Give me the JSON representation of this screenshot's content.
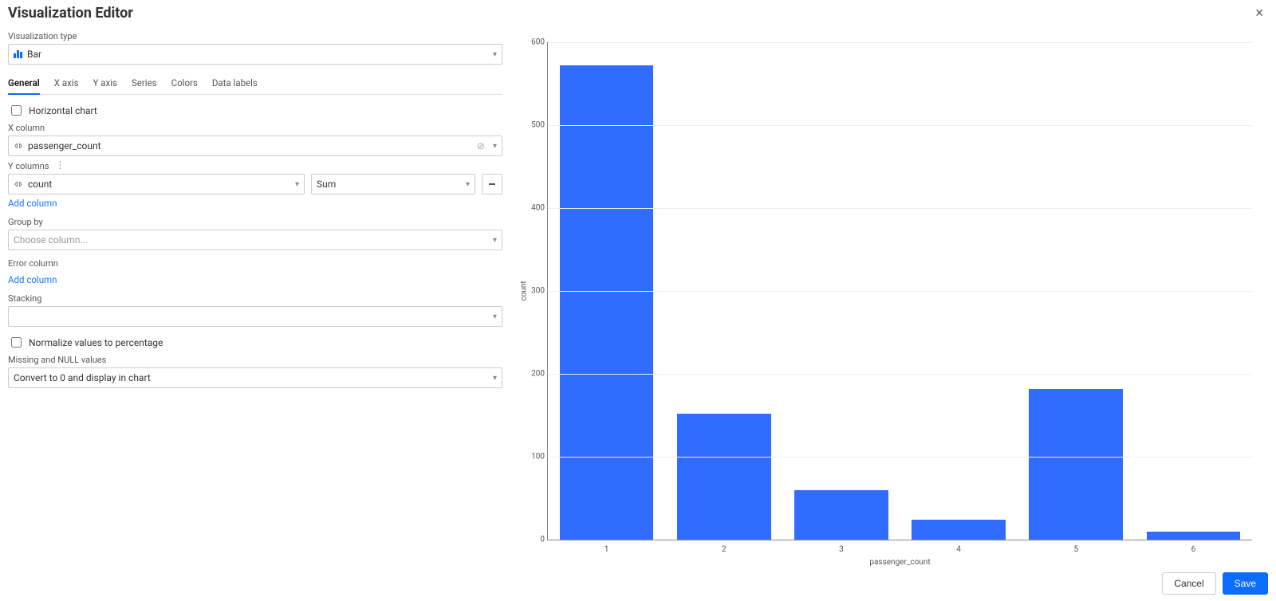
{
  "header": {
    "title": "Visualization Editor"
  },
  "viz_type": {
    "label": "Visualization type",
    "value": "Bar"
  },
  "tabs": [
    "General",
    "X axis",
    "Y axis",
    "Series",
    "Colors",
    "Data labels"
  ],
  "active_tab": "General",
  "general": {
    "horizontal_chart_label": "Horizontal chart",
    "horizontal_chart_checked": false,
    "x_column_label": "X column",
    "x_column_value": "passenger_count",
    "y_columns_label": "Y columns",
    "y_column_value": "count",
    "y_agg_value": "Sum",
    "add_column_label": "Add column",
    "group_by_label": "Group by",
    "group_by_placeholder": "Choose column...",
    "error_column_label": "Error column",
    "stacking_label": "Stacking",
    "stacking_value": "",
    "normalize_label": "Normalize values to percentage",
    "normalize_checked": false,
    "missing_label": "Missing and NULL values",
    "missing_value": "Convert to 0 and display in chart"
  },
  "buttons": {
    "cancel": "Cancel",
    "save": "Save"
  },
  "chart_data": {
    "type": "bar",
    "categories": [
      "1",
      "2",
      "3",
      "4",
      "5",
      "6"
    ],
    "values": [
      572,
      152,
      60,
      24,
      182,
      10
    ],
    "title": "",
    "xlabel": "passenger_count",
    "ylabel": "count",
    "ylim": [
      0,
      600
    ],
    "yticks": [
      0,
      100,
      200,
      300,
      400,
      500,
      600
    ]
  }
}
